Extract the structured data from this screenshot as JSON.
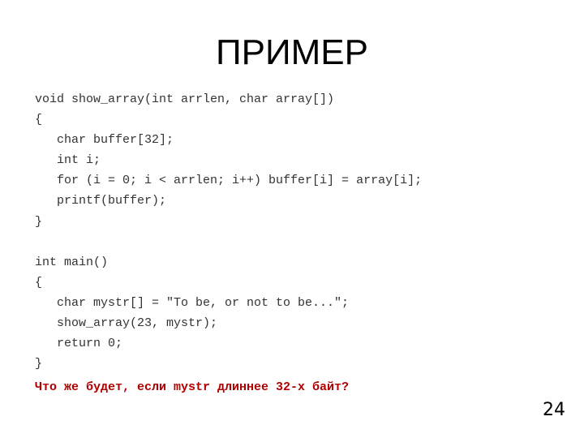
{
  "slide": {
    "title": "ПРИМЕР",
    "code_lines": [
      "void show_array(int arrlen, char array[])",
      "{",
      "   char buffer[32];",
      "   int i;",
      "   for (i = 0; i < arrlen; i++) buffer[i] = array[i];",
      "   printf(buffer);",
      "}",
      "",
      "int main()",
      "{",
      "   char mystr[] = \"To be, or not to be...\";",
      "   show_array(23, mystr);",
      "   return 0;",
      "}"
    ],
    "question": "Что же будет, если mystr длиннее 32-х байт?",
    "question_color": "#b00000",
    "slide_number": "24"
  }
}
